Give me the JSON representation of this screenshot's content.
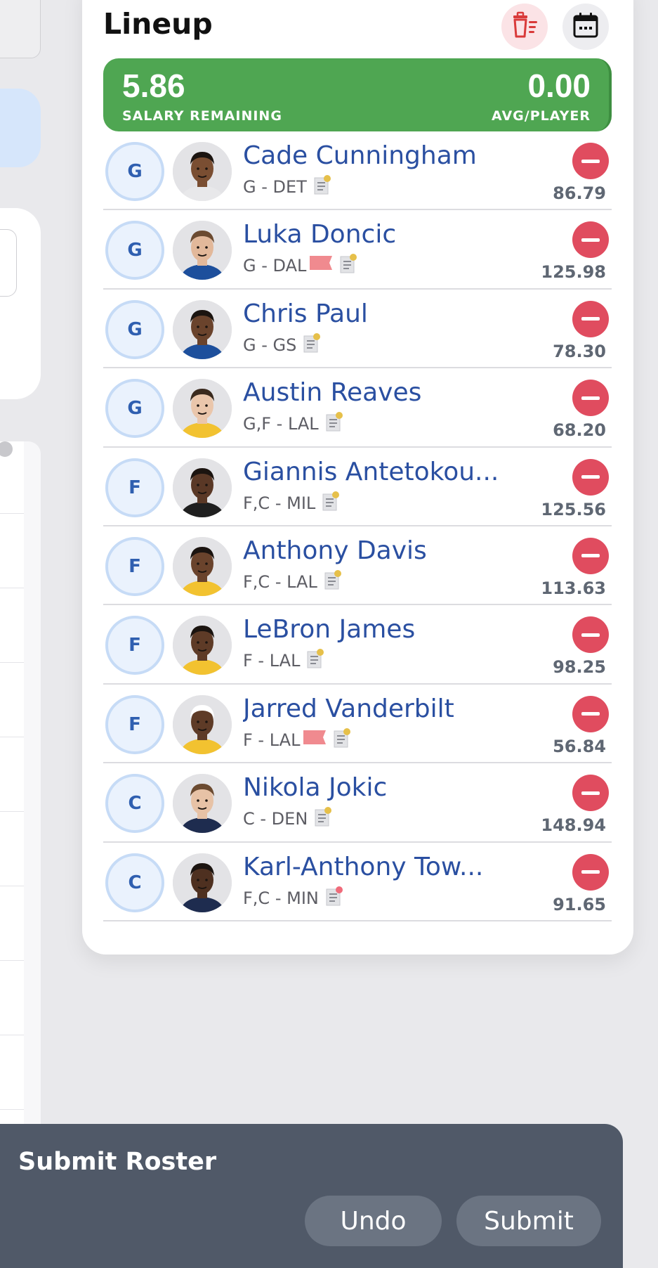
{
  "lineup": {
    "title": "Lineup",
    "salary_remaining": "5.86",
    "salary_remaining_label": "SALARY REMAINING",
    "avg_per_player": "0.00",
    "avg_per_player_label": "AVG/PLAYER",
    "colors": {
      "salary_bar": "#4fa652",
      "remove": "#e04c5f",
      "name": "#2a4fa1"
    },
    "players": [
      {
        "slot": "G",
        "name": "Cade Cunningham",
        "meta": "G - DET",
        "flag": false,
        "note_dot": "#e6c04a",
        "points": "86.79",
        "skin": "#7a4e32",
        "hair": "#1b1410",
        "jersey": "#e8e8ea"
      },
      {
        "slot": "G",
        "name": "Luka Doncic",
        "meta": "G - DAL",
        "flag": true,
        "note_dot": "#e6c04a",
        "points": "125.98",
        "skin": "#e2b89a",
        "hair": "#6b4a30",
        "jersey": "#1d4f9c"
      },
      {
        "slot": "G",
        "name": "Chris Paul",
        "meta": "G - GS",
        "flag": false,
        "note_dot": "#e6c04a",
        "points": "78.30",
        "skin": "#6a432c",
        "hair": "#1b1410",
        "jersey": "#1d4f9c"
      },
      {
        "slot": "G",
        "name": "Austin Reaves",
        "meta": "G,F - LAL",
        "flag": false,
        "note_dot": "#e6c04a",
        "points": "68.20",
        "skin": "#eac6ab",
        "hair": "#3a2a1e",
        "jersey": "#f2c230"
      },
      {
        "slot": "F",
        "name": "Giannis Antetokou...",
        "meta": "F,C - MIL",
        "flag": false,
        "note_dot": "#e6c04a",
        "points": "125.56",
        "skin": "#5a3826",
        "hair": "#1b1410",
        "jersey": "#1f1f1f"
      },
      {
        "slot": "F",
        "name": "Anthony Davis",
        "meta": "F,C - LAL",
        "flag": false,
        "note_dot": "#e6c04a",
        "points": "113.63",
        "skin": "#6a432c",
        "hair": "#1b1410",
        "jersey": "#f2c230"
      },
      {
        "slot": "F",
        "name": "LeBron James",
        "meta": "F - LAL",
        "flag": false,
        "note_dot": "#e6c04a",
        "points": "98.25",
        "skin": "#5e3b27",
        "hair": "#1b1410",
        "jersey": "#f2c230"
      },
      {
        "slot": "F",
        "name": "Jarred Vanderbilt",
        "meta": "F - LAL",
        "flag": true,
        "note_dot": "#e6c04a",
        "points": "56.84",
        "skin": "#5e3b27",
        "hair": "#ffffff",
        "jersey": "#f2c230"
      },
      {
        "slot": "C",
        "name": "Nikola Jokic",
        "meta": "C - DEN",
        "flag": false,
        "note_dot": "#e6c04a",
        "points": "148.94",
        "skin": "#e7c2a6",
        "hair": "#6b4a30",
        "jersey": "#1e2c4f"
      },
      {
        "slot": "C",
        "name": "Karl-Anthony Tow...",
        "meta": "F,C - MIN",
        "flag": false,
        "note_dot": "#f06b7a",
        "points": "91.65",
        "skin": "#4e3020",
        "hair": "#1b1410",
        "jersey": "#1e2c4f"
      }
    ]
  },
  "submit": {
    "title": "Submit Roster",
    "undo_label": "Undo",
    "submit_label": "Submit"
  },
  "icons": [
    "clear-lineup-icon",
    "calendar-icon",
    "note-icon",
    "flag-icon",
    "remove-icon"
  ]
}
